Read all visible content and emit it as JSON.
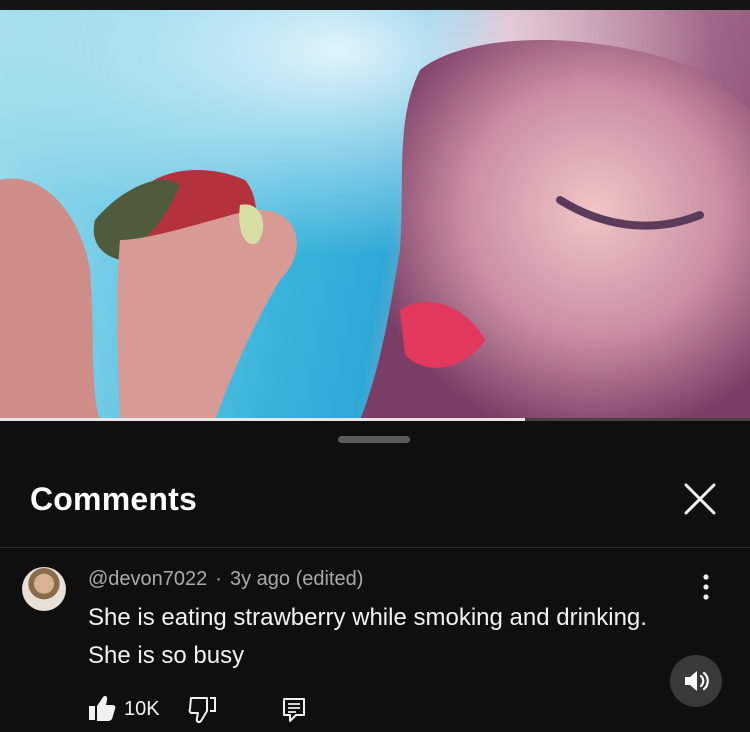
{
  "video": {
    "progress_fraction": 0.7
  },
  "panel": {
    "title": "Comments"
  },
  "comment": {
    "author": "@devon7022",
    "separator": "·",
    "time": "3y ago (edited)",
    "text": "She is eating strawberry while smoking and drinking. She is so busy",
    "likes": "10K"
  },
  "icons": {
    "close": "close-icon",
    "more": "more-vertical-icon",
    "sound": "volume-icon",
    "like": "thumb-up-icon",
    "dislike": "thumb-down-icon",
    "reply": "reply-comment-icon"
  },
  "colors": {
    "background": "#0f0f0f",
    "meta_text": "#aaaaaa",
    "primary_text": "#f1f1f1"
  }
}
